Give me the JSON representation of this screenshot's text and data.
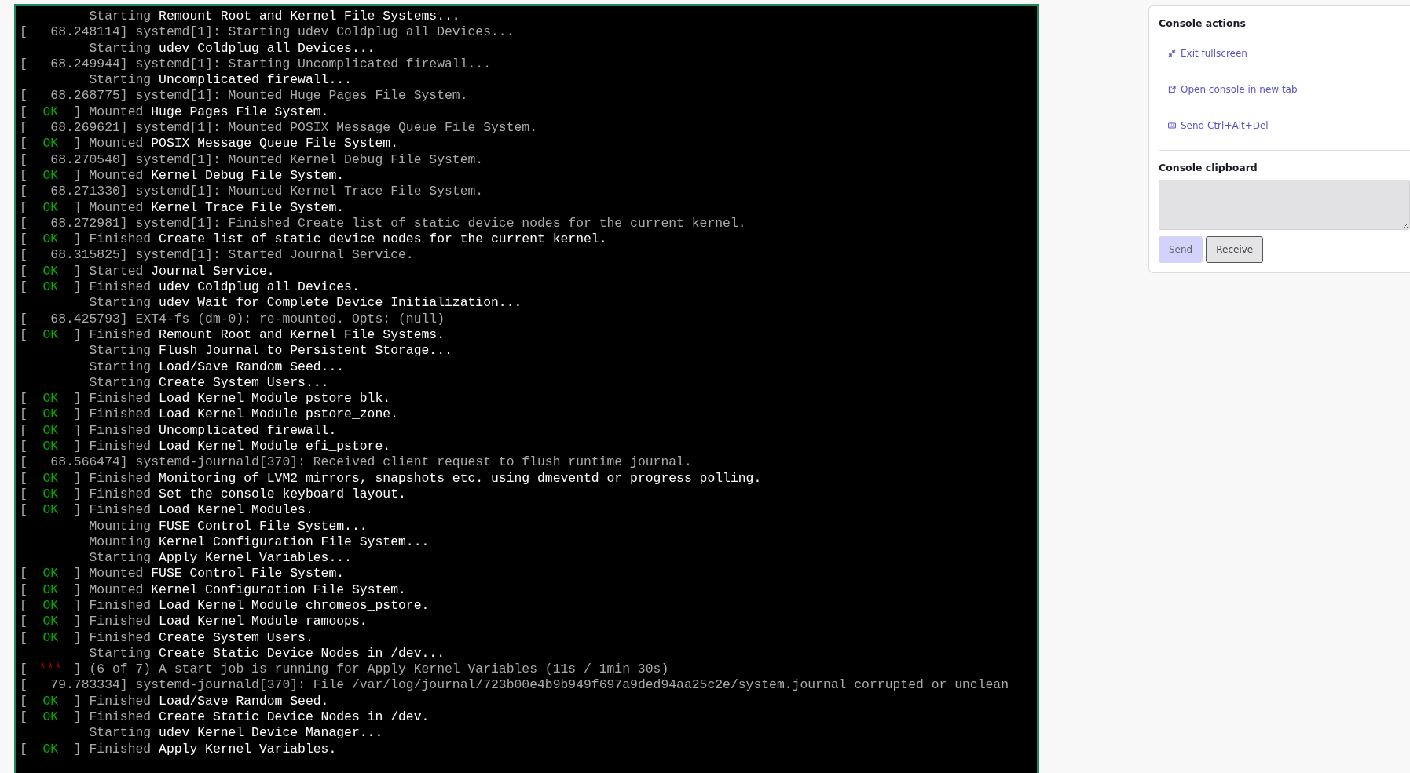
{
  "console": {
    "lines": [
      {
        "kind": "starting",
        "verb": "Starting",
        "text": "Remount Root and Kernel File Systems..."
      },
      {
        "kind": "kernel",
        "text": "[   68.248114] systemd[1]: Starting udev Coldplug all Devices..."
      },
      {
        "kind": "starting",
        "verb": "Starting",
        "text": "udev Coldplug all Devices..."
      },
      {
        "kind": "kernel",
        "text": "[   68.249944] systemd[1]: Starting Uncomplicated firewall..."
      },
      {
        "kind": "starting",
        "verb": "Starting",
        "text": "Uncomplicated firewall..."
      },
      {
        "kind": "kernel",
        "text": "[   68.268775] systemd[1]: Mounted Huge Pages File System."
      },
      {
        "kind": "ok",
        "status": [
          "[",
          "OK",
          "]"
        ],
        "verb": "Mounted",
        "text": "Huge Pages File System."
      },
      {
        "kind": "kernel",
        "text": "[   68.269621] systemd[1]: Mounted POSIX Message Queue File System."
      },
      {
        "kind": "ok",
        "status": [
          "[",
          "OK",
          "]"
        ],
        "verb": "Mounted",
        "text": "POSIX Message Queue File System."
      },
      {
        "kind": "kernel",
        "text": "[   68.270540] systemd[1]: Mounted Kernel Debug File System."
      },
      {
        "kind": "ok",
        "status": [
          "[",
          "OK",
          "]"
        ],
        "verb": "Mounted",
        "text": "Kernel Debug File System."
      },
      {
        "kind": "kernel",
        "text": "[   68.271330] systemd[1]: Mounted Kernel Trace File System."
      },
      {
        "kind": "ok",
        "status": [
          "[",
          "OK",
          "]"
        ],
        "verb": "Mounted",
        "text": "Kernel Trace File System."
      },
      {
        "kind": "kernel",
        "text": "[   68.272981] systemd[1]: Finished Create list of static device nodes for the current kernel."
      },
      {
        "kind": "ok",
        "status": [
          "[",
          "OK",
          "]"
        ],
        "verb": "Finished",
        "text": "Create list of static device nodes for the current kernel."
      },
      {
        "kind": "kernel",
        "text": "[   68.315825] systemd[1]: Started Journal Service."
      },
      {
        "kind": "ok",
        "status": [
          "[",
          "OK",
          "]"
        ],
        "verb": "Started",
        "text": "Journal Service."
      },
      {
        "kind": "ok",
        "status": [
          "[",
          "OK",
          "]"
        ],
        "verb": "Finished",
        "text": "udev Coldplug all Devices."
      },
      {
        "kind": "starting",
        "verb": "Starting",
        "text": "udev Wait for Complete Device Initialization..."
      },
      {
        "kind": "kernel",
        "text": "[   68.425793] EXT4-fs (dm-0): re-mounted. Opts: (null)"
      },
      {
        "kind": "ok",
        "status": [
          "[",
          "OK",
          "]"
        ],
        "verb": "Finished",
        "text": "Remount Root and Kernel File Systems."
      },
      {
        "kind": "starting",
        "verb": "Starting",
        "text": "Flush Journal to Persistent Storage..."
      },
      {
        "kind": "starting",
        "verb": "Starting",
        "text": "Load/Save Random Seed..."
      },
      {
        "kind": "starting",
        "verb": "Starting",
        "text": "Create System Users..."
      },
      {
        "kind": "ok",
        "status": [
          "[",
          "OK",
          "]"
        ],
        "verb": "Finished",
        "text": "Load Kernel Module pstore_blk."
      },
      {
        "kind": "ok",
        "status": [
          "[",
          "OK",
          "]"
        ],
        "verb": "Finished",
        "text": "Load Kernel Module pstore_zone."
      },
      {
        "kind": "ok",
        "status": [
          "[",
          "OK",
          "]"
        ],
        "verb": "Finished",
        "text": "Uncomplicated firewall."
      },
      {
        "kind": "ok",
        "status": [
          "[",
          "OK",
          "]"
        ],
        "verb": "Finished",
        "text": "Load Kernel Module efi_pstore."
      },
      {
        "kind": "kernel",
        "text": "[   68.566474] systemd-journald[370]: Received client request to flush runtime journal."
      },
      {
        "kind": "ok",
        "status": [
          "[",
          "OK",
          "]"
        ],
        "verb": "Finished",
        "text": "Monitoring of LVM2 mirrors, snapshots etc. using dmeventd or progress polling."
      },
      {
        "kind": "ok",
        "status": [
          "[",
          "OK",
          "]"
        ],
        "verb": "Finished",
        "text": "Set the console keyboard layout."
      },
      {
        "kind": "ok",
        "status": [
          "[",
          "OK",
          "]"
        ],
        "verb": "Finished",
        "text": "Load Kernel Modules."
      },
      {
        "kind": "starting",
        "verb": "Mounting",
        "text": "FUSE Control File System..."
      },
      {
        "kind": "starting",
        "verb": "Mounting",
        "text": "Kernel Configuration File System..."
      },
      {
        "kind": "starting",
        "verb": "Starting",
        "text": "Apply Kernel Variables..."
      },
      {
        "kind": "ok",
        "status": [
          "[",
          "OK",
          "]"
        ],
        "verb": "Mounted",
        "text": "FUSE Control File System."
      },
      {
        "kind": "ok",
        "status": [
          "[",
          "OK",
          "]"
        ],
        "verb": "Mounted",
        "text": "Kernel Configuration File System."
      },
      {
        "kind": "ok",
        "status": [
          "[",
          "OK",
          "]"
        ],
        "verb": "Finished",
        "text": "Load Kernel Module chromeos_pstore."
      },
      {
        "kind": "ok",
        "status": [
          "[",
          "OK",
          "]"
        ],
        "verb": "Finished",
        "text": "Load Kernel Module ramoops."
      },
      {
        "kind": "ok",
        "status": [
          "[",
          "OK",
          "]"
        ],
        "verb": "Finished",
        "text": "Create System Users."
      },
      {
        "kind": "starting",
        "verb": "Starting",
        "text": "Create Static Device Nodes in /dev..."
      },
      {
        "kind": "job",
        "status": [
          "[",
          "***",
          "]"
        ],
        "text": "(6 of 7) A start job is running for Apply Kernel Variables (11s / 1min 30s)"
      },
      {
        "kind": "kernel",
        "text": "[   79.783334] systemd-journald[370]: File /var/log/journal/723b00e4b9b949f697a9ded94aa25c2e/system.journal corrupted or unclean"
      },
      {
        "kind": "ok",
        "status": [
          "[",
          "OK",
          "]"
        ],
        "verb": "Finished",
        "text": "Load/Save Random Seed."
      },
      {
        "kind": "ok",
        "status": [
          "[",
          "OK",
          "]"
        ],
        "verb": "Finished",
        "text": "Create Static Device Nodes in /dev."
      },
      {
        "kind": "starting",
        "verb": "Starting",
        "text": "udev Kernel Device Manager..."
      },
      {
        "kind": "ok",
        "status": [
          "[",
          "OK",
          "]"
        ],
        "verb": "Finished",
        "text": "Apply Kernel Variables."
      }
    ]
  },
  "actions": {
    "title": "Console actions",
    "items": [
      {
        "kind": "exit-fullscreen",
        "label": "Exit fullscreen"
      },
      {
        "kind": "new-tab",
        "label": "Open console in new tab"
      },
      {
        "kind": "keyboard",
        "label": "Send Ctrl+Alt+Del"
      }
    ]
  },
  "clipboard": {
    "title": "Console clipboard",
    "buttons": [
      {
        "label": "Send",
        "kind": "primary",
        "disabled": true
      },
      {
        "label": "Receive",
        "kind": "secondary",
        "disabled": false
      }
    ]
  }
}
